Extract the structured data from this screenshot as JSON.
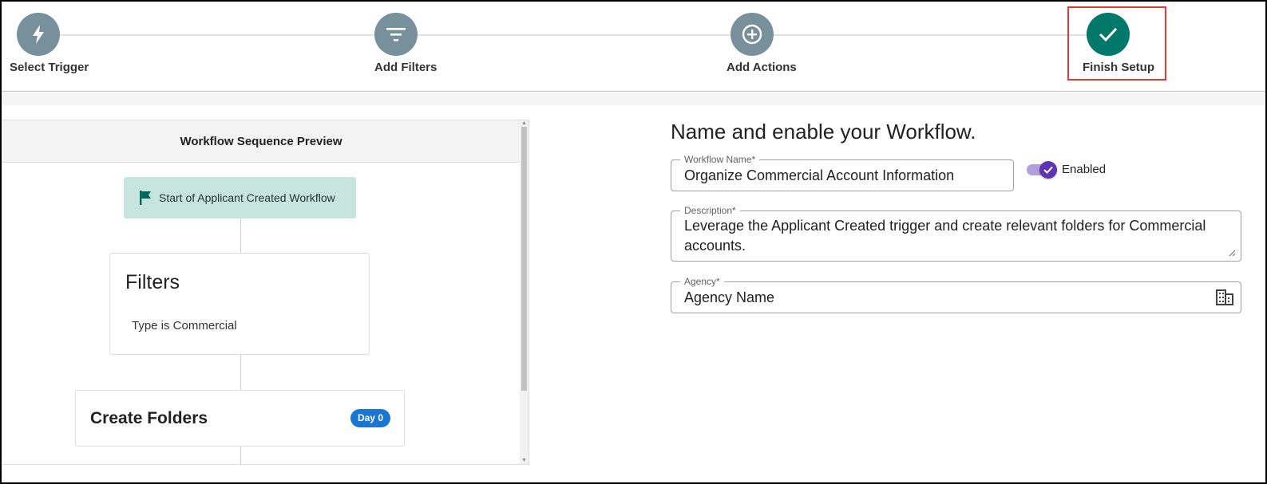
{
  "stepper": {
    "steps": [
      {
        "label": "Select Trigger",
        "icon": "bolt-icon",
        "state": "complete"
      },
      {
        "label": "Add Filters",
        "icon": "filter-icon",
        "state": "complete"
      },
      {
        "label": "Add Actions",
        "icon": "plus-circle-icon",
        "state": "complete"
      },
      {
        "label": "Finish Setup",
        "icon": "check-icon",
        "state": "current"
      }
    ]
  },
  "preview": {
    "header": "Workflow Sequence Preview",
    "start_node": {
      "label": "Start of Applicant Created Workflow",
      "icon": "flag-icon"
    },
    "filters": {
      "title": "Filters",
      "rules": [
        "Type is Commercial"
      ]
    },
    "action": {
      "title": "Create Folders",
      "badge": "Day 0"
    }
  },
  "form": {
    "heading": "Name and enable your Workflow.",
    "workflow_name": {
      "label": "Workflow Name*",
      "value": "Organize Commercial Account Information"
    },
    "enabled": {
      "label": "Enabled",
      "checked": true
    },
    "description": {
      "label": "Description*",
      "value": "Leverage the Applicant Created trigger and create relevant folders for Commercial accounts."
    },
    "agency": {
      "label": "Agency*",
      "value": "Agency Name",
      "icon": "building-icon"
    }
  },
  "colors": {
    "step_inactive": "#78909c",
    "step_done": "#00796b",
    "highlight": "#e53935",
    "start_node_bg": "#c7e4df",
    "badge": "#1976d2",
    "toggle": "#5e35b1"
  }
}
